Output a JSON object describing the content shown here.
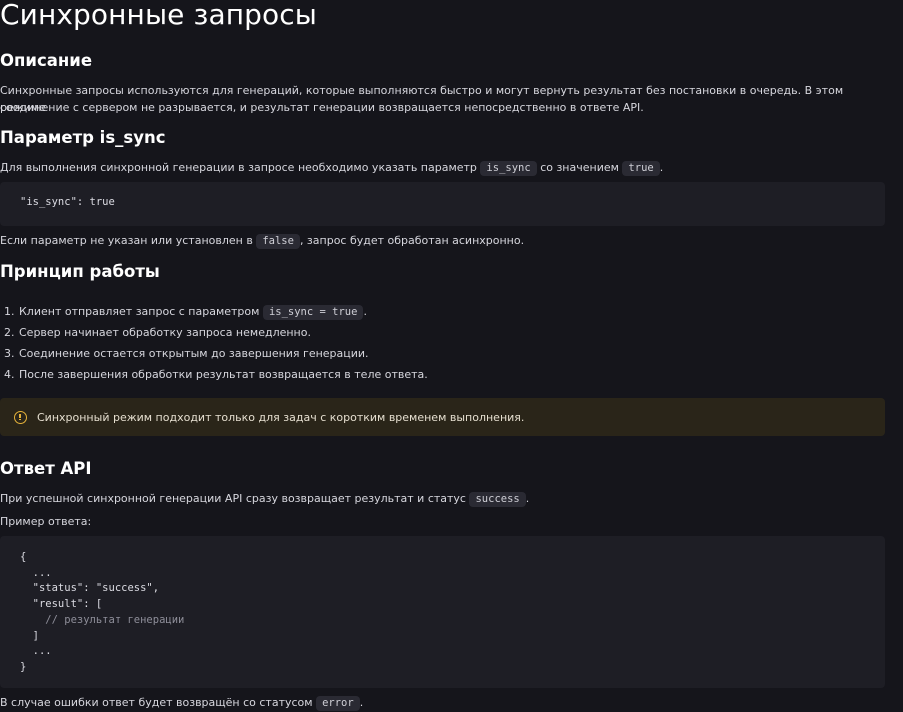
{
  "title": "Синхронные запросы",
  "sections": {
    "description": {
      "heading": "Описание",
      "text1": "Синхронные запросы используются для генераций, которые выполняются быстро и могут вернуть результат без постановки в очередь. В этом режиме",
      "text2": "соединение с сервером не разрывается, и результат генерации возвращается непосредственно в ответе API."
    },
    "param": {
      "heading": "Параметр is_sync",
      "text_before": "Для выполнения синхронной генерации в запросе необходимо указать параметр",
      "code1": "is_sync",
      "text_mid": "со значением",
      "code2": "true",
      "text_end": ".",
      "block": "\"is_sync\": true",
      "after_before": "Если параметр не указан или установлен в",
      "after_code": "false",
      "after_end": ", запрос будет обработан асинхронно."
    },
    "principle": {
      "heading": "Принцип работы",
      "items": [
        {
          "num": "1.",
          "text": "Клиент отправляет запрос с параметром",
          "code": "is_sync = true",
          "end": "."
        },
        {
          "num": "2.",
          "text": "Сервер начинает обработку запроса немедленно."
        },
        {
          "num": "3.",
          "text": "Соединение остается открытым до завершения генерации."
        },
        {
          "num": "4.",
          "text": "После завершения обработки результат возвращается в теле ответа."
        }
      ],
      "warning": "Синхронный режим подходит только для задач с коротким временем выполнения."
    },
    "api": {
      "heading": "Ответ API",
      "text_before": "При успешной синхронной генерации API сразу возвращает результат и статус",
      "code": "success",
      "text_end": ".",
      "example_label": "Пример ответа:",
      "example_lines": [
        "{",
        "  ...",
        "  \"status\": \"success\",",
        "  \"result\": [",
        "    // результат генерации",
        "  ]",
        "  ...",
        "}"
      ],
      "error_before": "В случае ошибки ответ будет возвращён со статусом",
      "error_code": "error",
      "error_end": "."
    }
  },
  "colors": {
    "background": "#15151b",
    "code_bg": "#1e1e25",
    "warning_bg": "#2a2519",
    "warning_icon": "#e5b23a"
  },
  "icons": {
    "warning": "warning-icon"
  }
}
